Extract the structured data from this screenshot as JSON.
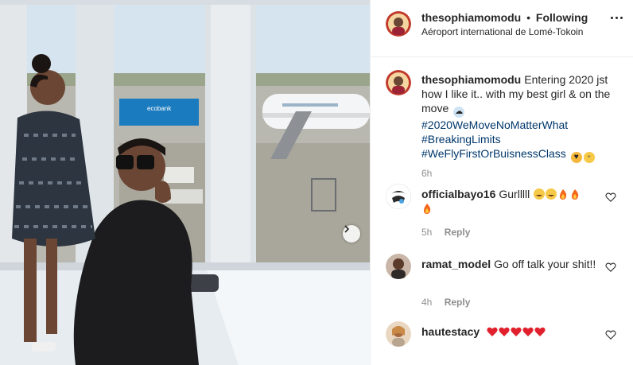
{
  "post": {
    "username": "thesophiamomodu",
    "separator": "•",
    "follow_status": "Following",
    "location": "Aéroport international de Lomé-Tokoin"
  },
  "photo": {
    "sign_text": "ecobank",
    "next_icon": "chevron-right-icon"
  },
  "caption": {
    "username": "thesophiamomodu",
    "text": "Entering 2020 jst how I like it.. with my best girl & on the move",
    "hashtags": [
      "#2020WeMoveNoMatterWhat",
      "#BreakingLimits",
      "#WeFlyFirstOrBuisnessClass"
    ],
    "time": "6h"
  },
  "comments": [
    {
      "username": "officialbayo16",
      "text": "Gurlllll",
      "time": "5h",
      "reply_label": "Reply"
    },
    {
      "username": "ramat_model",
      "text": "Go off talk your shit!!",
      "time": "4h",
      "reply_label": "Reply"
    },
    {
      "username": "hautestacy",
      "text": ""
    }
  ],
  "colors": {
    "text": "#262626",
    "muted": "#8e8e8e",
    "hashtag": "#00376b",
    "border": "#efefef",
    "heart_red": "#e0212d"
  },
  "icons": [
    "more-icon",
    "heart-outline-icon",
    "chevron-right-icon",
    "cloud-emoji-icon",
    "grin-emoji-icon",
    "heart-eyes-emoji-icon",
    "fire-emoji-icon",
    "red-heart-emoji-icon"
  ]
}
